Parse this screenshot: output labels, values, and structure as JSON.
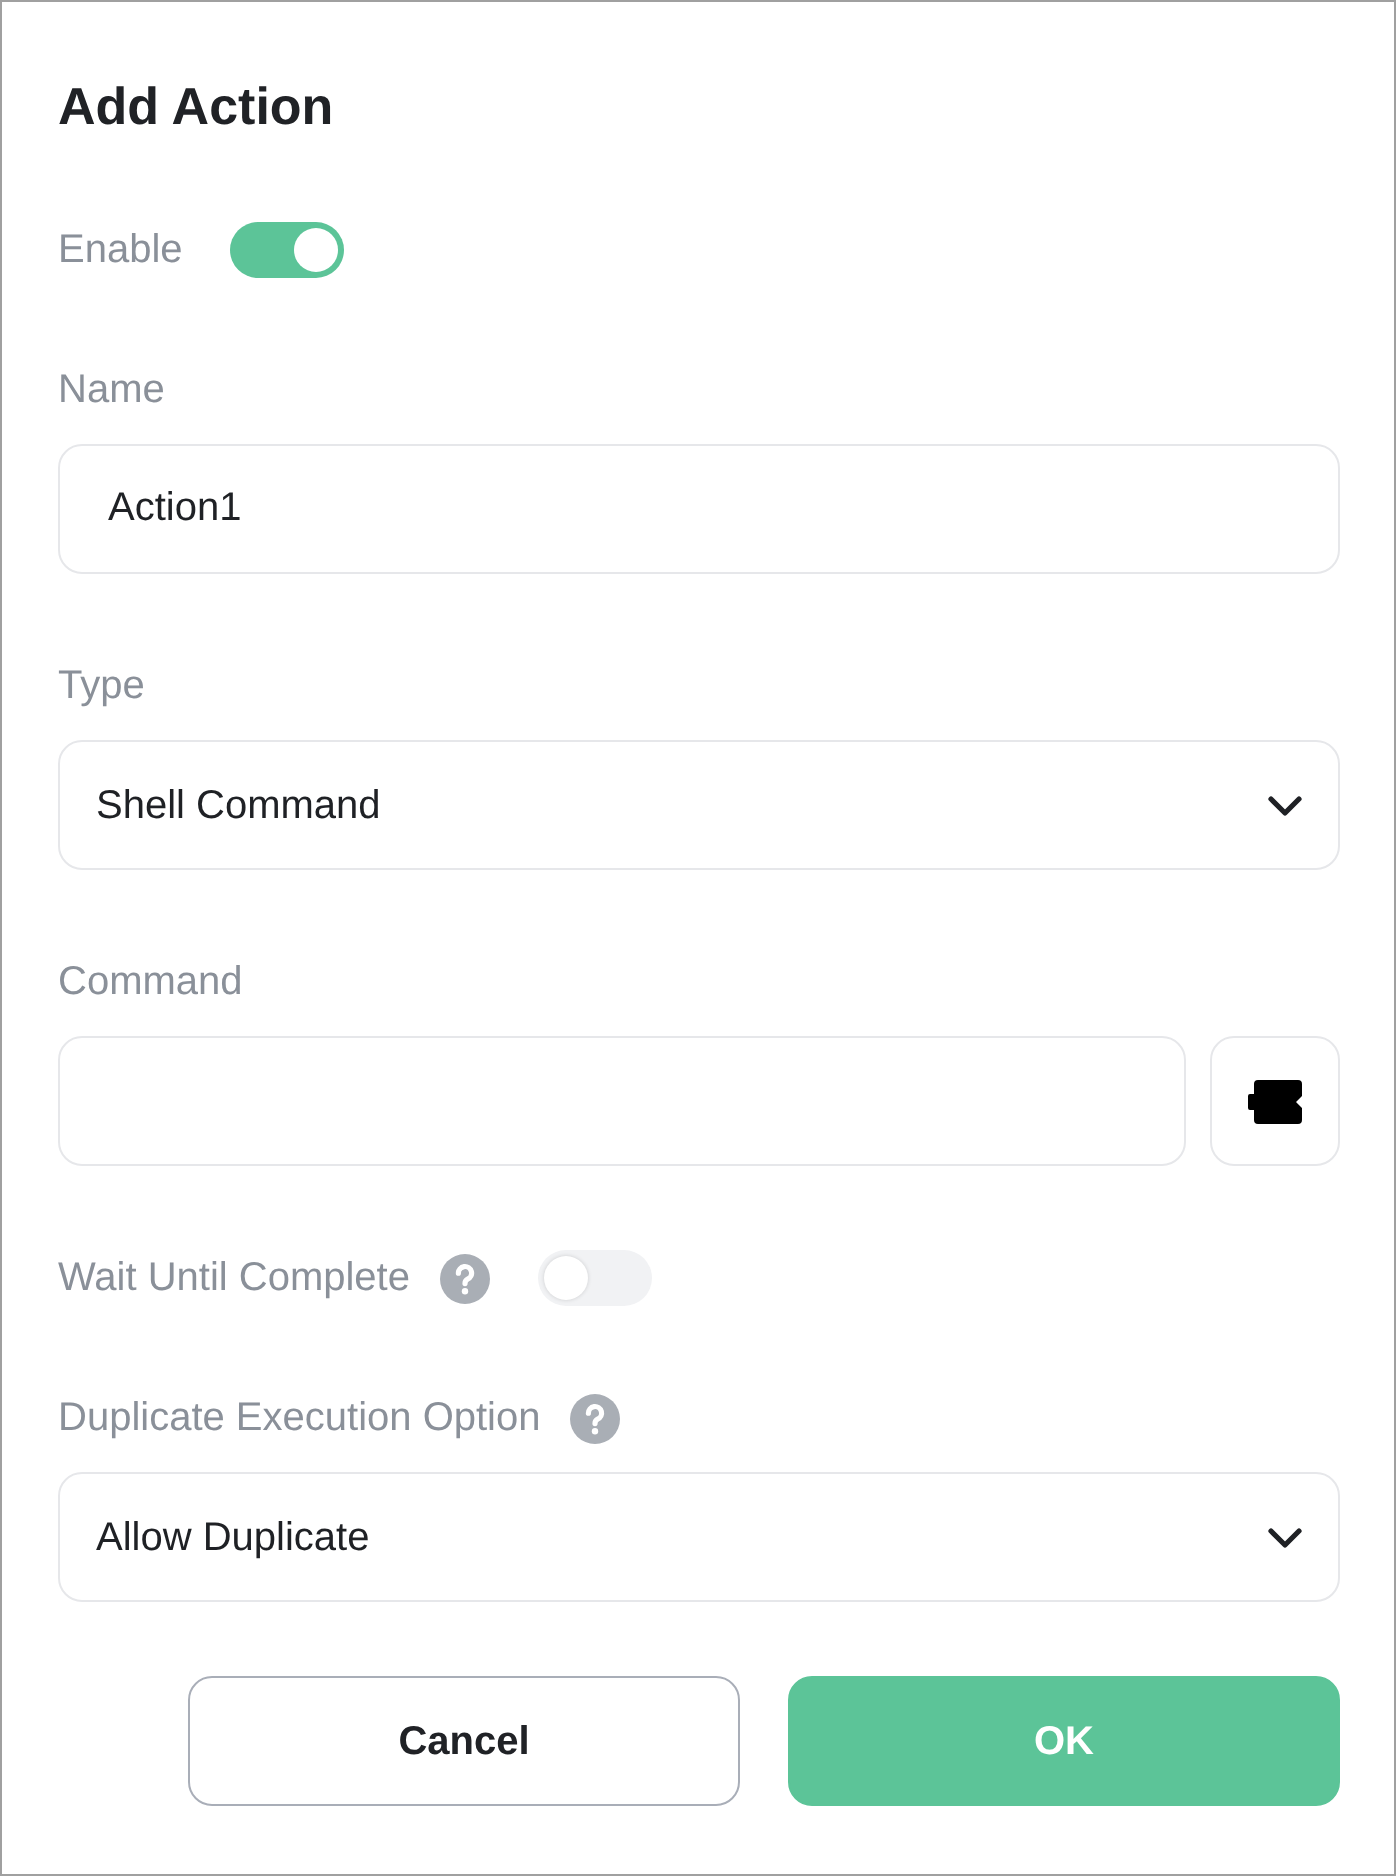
{
  "dialog": {
    "title": "Add Action"
  },
  "fields": [
    {
      "kind": "toggle",
      "label": "Enable",
      "on": true
    },
    {
      "kind": "text",
      "label": "Name",
      "value": "Action1"
    },
    {
      "kind": "select",
      "label": "Type",
      "value": "Shell Command"
    },
    {
      "kind": "text_with_button",
      "label": "Command"
    },
    {
      "kind": "toggle",
      "label": "Wait Until Complete",
      "help": true,
      "on": false
    },
    {
      "kind": "select",
      "label": "Duplicate Execution Option",
      "help": true,
      "value": "Allow Duplicate"
    }
  ],
  "buttons": [
    {
      "kind": "secondary",
      "label": "Cancel"
    },
    {
      "kind": "primary",
      "label": "OK"
    }
  ]
}
